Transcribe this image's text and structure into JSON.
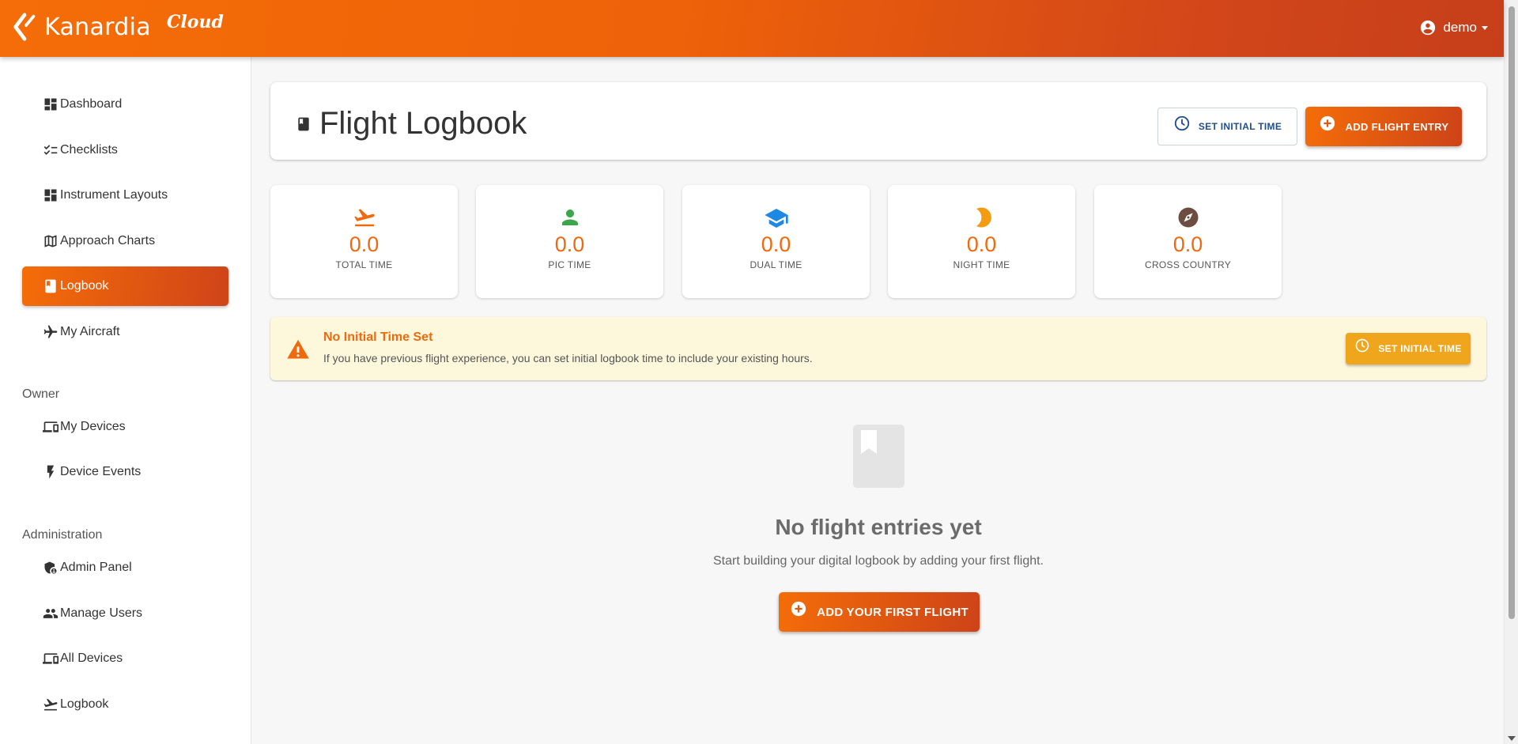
{
  "brand": {
    "name": "Kanardia",
    "product": "Cloud"
  },
  "user": {
    "name": "demo"
  },
  "sidebar": {
    "items": [
      {
        "label": "Dashboard",
        "icon": "dashboard-icon"
      },
      {
        "label": "Checklists",
        "icon": "checklist-icon"
      },
      {
        "label": "Instrument Layouts",
        "icon": "dashboard-icon"
      },
      {
        "label": "Approach Charts",
        "icon": "map-icon"
      },
      {
        "label": "Logbook",
        "icon": "book-icon",
        "active": true
      },
      {
        "label": "My Aircraft",
        "icon": "airplane-icon"
      }
    ],
    "owner_section": "Owner",
    "owner_items": [
      {
        "label": "My Devices",
        "icon": "devices-icon"
      },
      {
        "label": "Device Events",
        "icon": "bolt-icon"
      }
    ],
    "admin_section": "Administration",
    "admin_items": [
      {
        "label": "Admin Panel",
        "icon": "admin-shield-icon"
      },
      {
        "label": "Manage Users",
        "icon": "users-icon"
      },
      {
        "label": "All Devices",
        "icon": "devices-icon"
      },
      {
        "label": "Logbook",
        "icon": "takeoff-icon"
      }
    ]
  },
  "header": {
    "title": "Flight Logbook",
    "set_initial_time": "SET INITIAL TIME",
    "add_flight_entry": "ADD FLIGHT ENTRY"
  },
  "stats": [
    {
      "value": "0.0",
      "label": "TOTAL TIME",
      "icon": "takeoff-icon",
      "color": "#ee6a0d"
    },
    {
      "value": "0.0",
      "label": "PIC TIME",
      "icon": "person-icon",
      "color": "#3aa74a"
    },
    {
      "value": "0.0",
      "label": "DUAL TIME",
      "icon": "graduation-cap-icon",
      "color": "#1e88e5"
    },
    {
      "value": "0.0",
      "label": "NIGHT TIME",
      "icon": "moon-icon",
      "color": "#f39c12"
    },
    {
      "value": "0.0",
      "label": "CROSS COUNTRY",
      "icon": "compass-icon",
      "color": "#6d4c41"
    }
  ],
  "alert": {
    "title": "No Initial Time Set",
    "text": "If you have previous flight experience, you can set initial logbook time to include your existing hours.",
    "button": "SET INITIAL TIME"
  },
  "empty_state": {
    "title": "No flight entries yet",
    "text": "Start building your digital logbook by adding your first flight.",
    "button": "ADD YOUR FIRST FLIGHT"
  }
}
